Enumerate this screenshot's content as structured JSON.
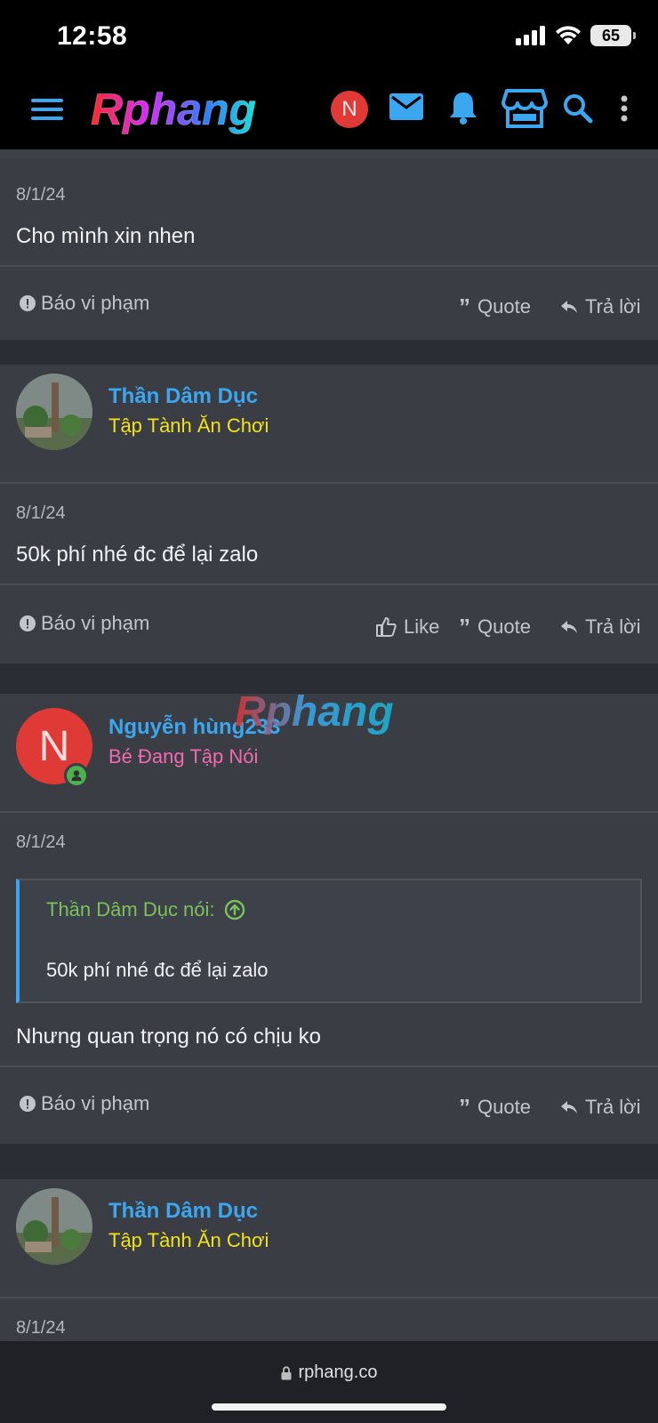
{
  "status": {
    "time": "12:58",
    "battery": "65"
  },
  "nav": {
    "logo_text": "Rphang",
    "user_initial": "N",
    "colors": {
      "accent": "#3aa7f0",
      "avatar": "#e03a37"
    }
  },
  "posts": [
    {
      "date": "8/1/24",
      "message": "Cho mình xin nhen",
      "report": "Báo vi phạm",
      "quote": "Quote",
      "reply": "Trả lời"
    },
    {
      "user": "Thần Dâm Dục",
      "user_title": "Tập Tành Ăn Chơi",
      "date": "8/1/24",
      "message": "50k phí nhé đc để lại zalo",
      "report": "Báo vi phạm",
      "like": "Like",
      "quote": "Quote",
      "reply": "Trả lời"
    },
    {
      "user": "Nguyễn hùng233",
      "avatar_initial": "N",
      "user_title": "Bé Đang Tập Nói",
      "date": "8/1/24",
      "quote_author": "Thần Dâm Dục nói:",
      "quote_text": "50k phí nhé đc để lại zalo",
      "message": "Nhưng quan trọng nó có chịu ko",
      "report": "Báo vi phạm",
      "quote": "Quote",
      "reply": "Trả lời"
    },
    {
      "user": "Thần Dâm Dục",
      "user_title": "Tập Tành Ăn Chơi",
      "date": "8/1/24"
    }
  ],
  "watermark": "Rphang",
  "browser": {
    "url": "rphang.co"
  }
}
